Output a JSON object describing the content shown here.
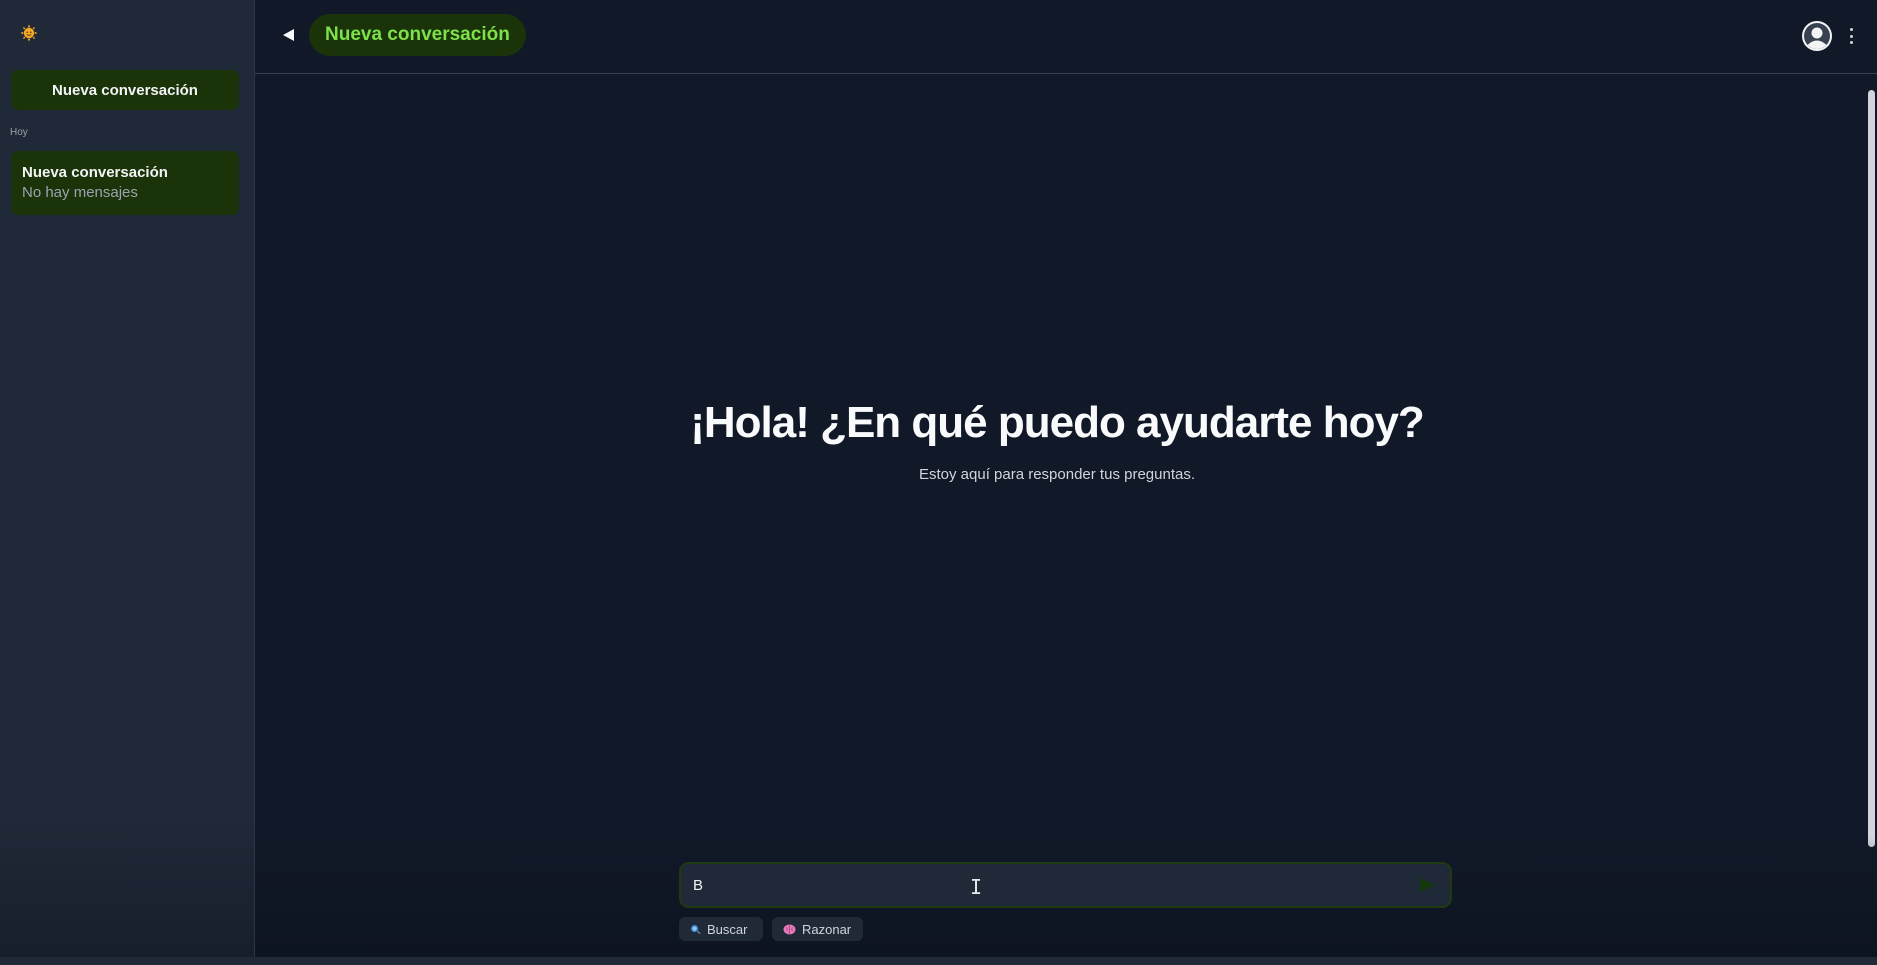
{
  "sidebar": {
    "logo_icon": "sun-face-icon",
    "new_chat_label": "Nueva conversación",
    "group_label": "Hoy",
    "conversations": [
      {
        "title": "Nueva conversación",
        "subtitle": "No hay mensajes"
      }
    ]
  },
  "header": {
    "collapse_icon": "triangle-left-icon",
    "title": "Nueva conversación",
    "avatar_icon": "user-avatar-icon",
    "menu_icon": "more-vertical-icon"
  },
  "welcome": {
    "heading": "¡Hola! ¿En qué puedo ayudarte hoy?",
    "subheading": "Estoy aquí para responder tus preguntas."
  },
  "composer": {
    "value": "B",
    "send_icon": "send-icon"
  },
  "tools": [
    {
      "label": "Buscar",
      "icon": "magnifier-icon"
    },
    {
      "label": "Razonar",
      "icon": "brain-icon"
    }
  ],
  "colors": {
    "accent_green": "#7ee04a",
    "accent_bg": "#1a3309",
    "sidebar_bg": "#1f2937",
    "main_bg": "#111827"
  }
}
